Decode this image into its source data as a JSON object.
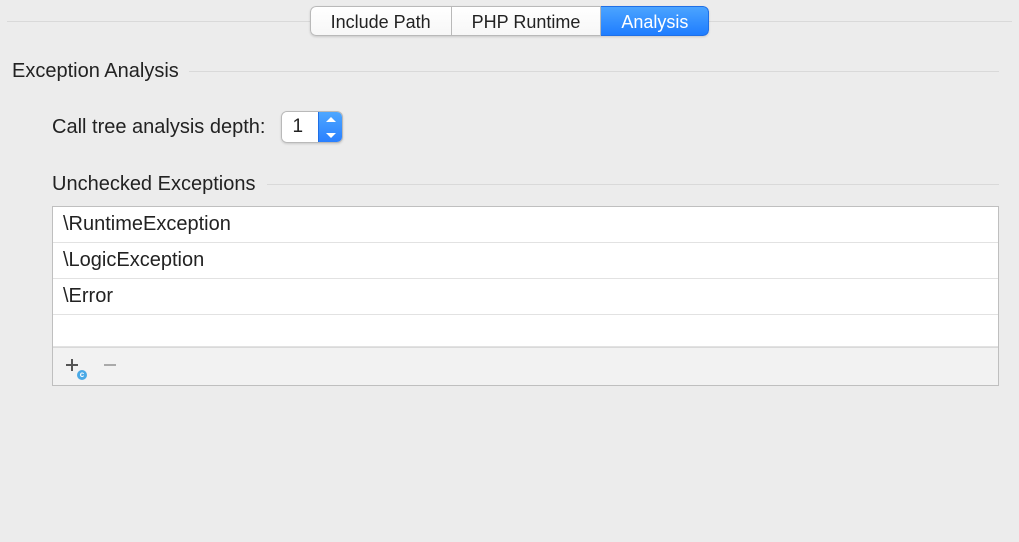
{
  "tabs": [
    {
      "label": "Include Path",
      "active": false
    },
    {
      "label": "PHP Runtime",
      "active": false
    },
    {
      "label": "Analysis",
      "active": true
    }
  ],
  "section": {
    "title": "Exception Analysis",
    "depth_label": "Call tree analysis depth:",
    "depth_value": "1",
    "sub_title": "Unchecked Exceptions",
    "exceptions": [
      "\\RuntimeException",
      "\\LogicException",
      "\\Error"
    ],
    "add_badge": "c"
  }
}
